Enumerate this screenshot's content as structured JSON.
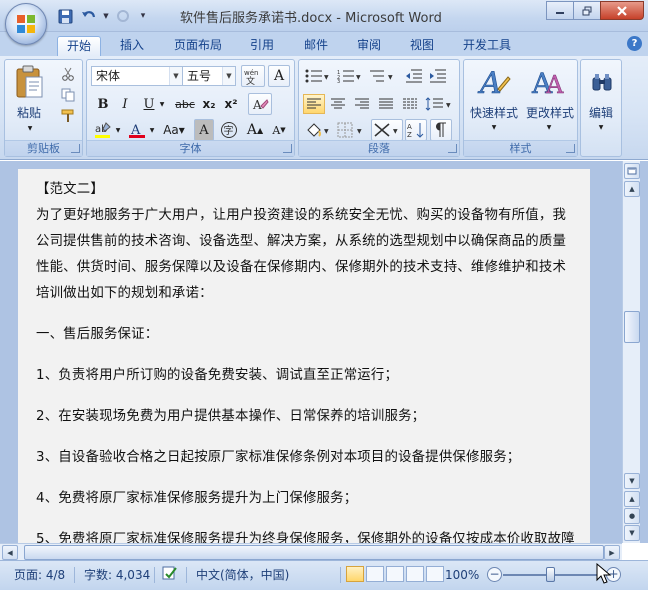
{
  "window": {
    "title": "软件售后服务承诺书.docx - Microsoft Word"
  },
  "quick_access": {
    "items": [
      "save-icon",
      "undo-icon",
      "redo-icon",
      "customize-qat-icon"
    ]
  },
  "tabs": [
    {
      "label": "开始",
      "active": true
    },
    {
      "label": "插入"
    },
    {
      "label": "页面布局"
    },
    {
      "label": "引用"
    },
    {
      "label": "邮件"
    },
    {
      "label": "审阅"
    },
    {
      "label": "视图"
    },
    {
      "label": "开发工具"
    }
  ],
  "ribbon": {
    "clipboard": {
      "label": "剪贴板",
      "paste_label": "粘贴"
    },
    "font": {
      "label": "字体",
      "font_name": "宋体",
      "font_size": "五号",
      "wen_label": "wén\n變",
      "a_label": "A"
    },
    "paragraph": {
      "label": "段落"
    },
    "styles": {
      "label": "样式",
      "quick_styles": "快速样式",
      "change_styles": "更改样式"
    },
    "editing": {
      "label": "编辑"
    }
  },
  "document": {
    "lines": [
      "【范文二】",
      "为了更好地服务于广大用户，让用户投资建设的系统安全无忧、购买的设备物有所值，我",
      "公司提供售前的技术咨询、设备选型、解决方案，从系统的选型规划中以确保商品的质量",
      "性能、供货时间、服务保障以及设备在保修期内、保修期外的技术支持、维修维护和技术",
      "培训做出如下的规划和承诺：",
      "一、售后服务保证：",
      "1、负责将用户所订购的设备免费安装、调试直至正常运行；",
      "2、在安装现场免费为用户提供基本操作、日常保养的培训服务；",
      "3、自设备验收合格之日起按原厂家标准保修条例对本项目的设备提供保修服务；",
      "4、免费将原厂家标准保修服务提升为上门保修服务；",
      "5、免费将原厂家标准保修服务提升为终身保修服务，保修期外的设备仅按成本价收取故障"
    ]
  },
  "status": {
    "page": "页面: 4/8",
    "words": "字数: 4,034",
    "language": "中文(简体，中国)",
    "zoom": "100%",
    "zoom_level": 100
  },
  "colors": {
    "accent": "#15428b",
    "font_color_bar": "#e0001b",
    "highlight_bar": "#ffff00"
  }
}
